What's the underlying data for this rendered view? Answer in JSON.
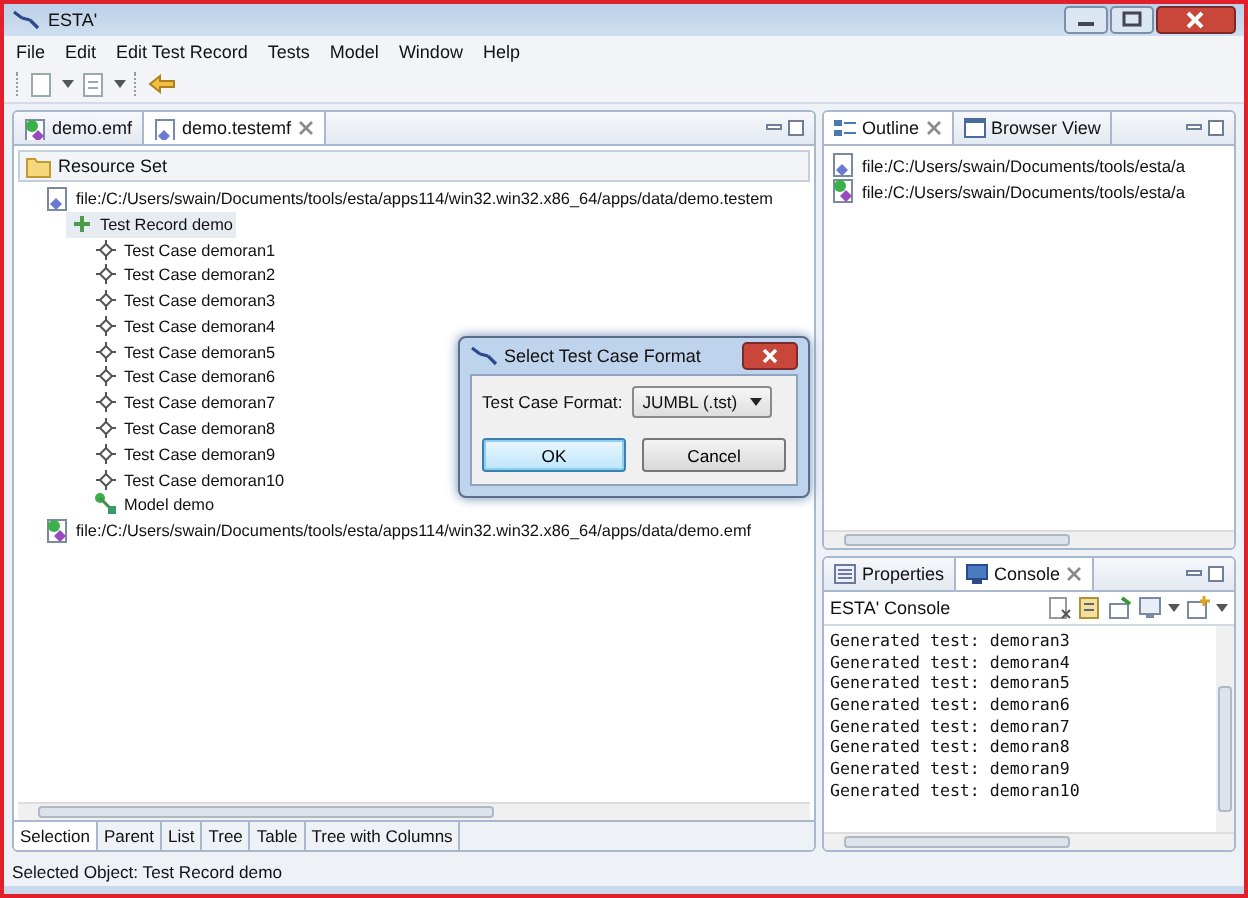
{
  "window": {
    "title": "ESTA'"
  },
  "menu": [
    "File",
    "Edit",
    "Edit Test Record",
    "Tests",
    "Model",
    "Window",
    "Help"
  ],
  "editor": {
    "tabs": [
      {
        "label": "demo.emf",
        "selected": false,
        "closable": false
      },
      {
        "label": "demo.testemf",
        "selected": true,
        "closable": true
      }
    ],
    "header": "Resource Set",
    "tree": [
      {
        "label": "file:/C:/Users/swain/Documents/tools/esta/apps114/win32.win32.x86_64/apps/data/demo.testem",
        "kind": "file",
        "selected": false,
        "children": [
          {
            "label": "Test Record demo",
            "kind": "record",
            "selected": true,
            "children": [
              {
                "label": "Test Case demoran1",
                "kind": "case",
                "selected": false
              },
              {
                "label": "Test Case demoran2",
                "kind": "case",
                "selected": false
              },
              {
                "label": "Test Case demoran3",
                "kind": "case",
                "selected": false
              },
              {
                "label": "Test Case demoran4",
                "kind": "case",
                "selected": false
              },
              {
                "label": "Test Case demoran5",
                "kind": "case",
                "selected": false
              },
              {
                "label": "Test Case demoran6",
                "kind": "case",
                "selected": false
              },
              {
                "label": "Test Case demoran7",
                "kind": "case",
                "selected": false
              },
              {
                "label": "Test Case demoran8",
                "kind": "case",
                "selected": false
              },
              {
                "label": "Test Case demoran9",
                "kind": "case",
                "selected": false
              },
              {
                "label": "Test Case demoran10",
                "kind": "case",
                "selected": false
              },
              {
                "label": "Model demo",
                "kind": "model",
                "selected": false
              }
            ]
          }
        ]
      },
      {
        "label": "file:/C:/Users/swain/Documents/tools/esta/apps114/win32.win32.x86_64/apps/data/demo.emf",
        "kind": "model-file",
        "selected": false
      }
    ],
    "bottom_tabs": [
      {
        "label": "Selection",
        "selected": true
      },
      {
        "label": "Parent",
        "selected": false
      },
      {
        "label": "List",
        "selected": false
      },
      {
        "label": "Tree",
        "selected": false
      },
      {
        "label": "Table",
        "selected": false
      },
      {
        "label": "Tree with Columns",
        "selected": false
      }
    ]
  },
  "outline": {
    "tabs": [
      {
        "label": "Outline",
        "selected": true,
        "closable": true
      },
      {
        "label": "Browser View",
        "selected": false,
        "closable": false
      }
    ],
    "items": [
      {
        "label": "file:/C:/Users/swain/Documents/tools/esta/a",
        "kind": "file"
      },
      {
        "label": "file:/C:/Users/swain/Documents/tools/esta/a",
        "kind": "model-file"
      }
    ]
  },
  "console": {
    "tabs": [
      {
        "label": "Properties",
        "selected": false,
        "closable": false
      },
      {
        "label": "Console",
        "selected": true,
        "closable": true
      }
    ],
    "title": "ESTA' Console",
    "lines": [
      "Generated test: demoran3",
      "Generated test: demoran4",
      "Generated test: demoran5",
      "Generated test: demoran6",
      "Generated test: demoran7",
      "Generated test: demoran8",
      "Generated test: demoran9",
      "Generated test: demoran10"
    ]
  },
  "dialog": {
    "title": "Select Test Case Format",
    "field_label": "Test Case Format:",
    "value": "JUMBL (.tst)",
    "buttons": [
      {
        "label": "OK",
        "default": true
      },
      {
        "label": "Cancel",
        "default": false
      }
    ]
  },
  "status_bar": "Selected Object: Test Record demo"
}
